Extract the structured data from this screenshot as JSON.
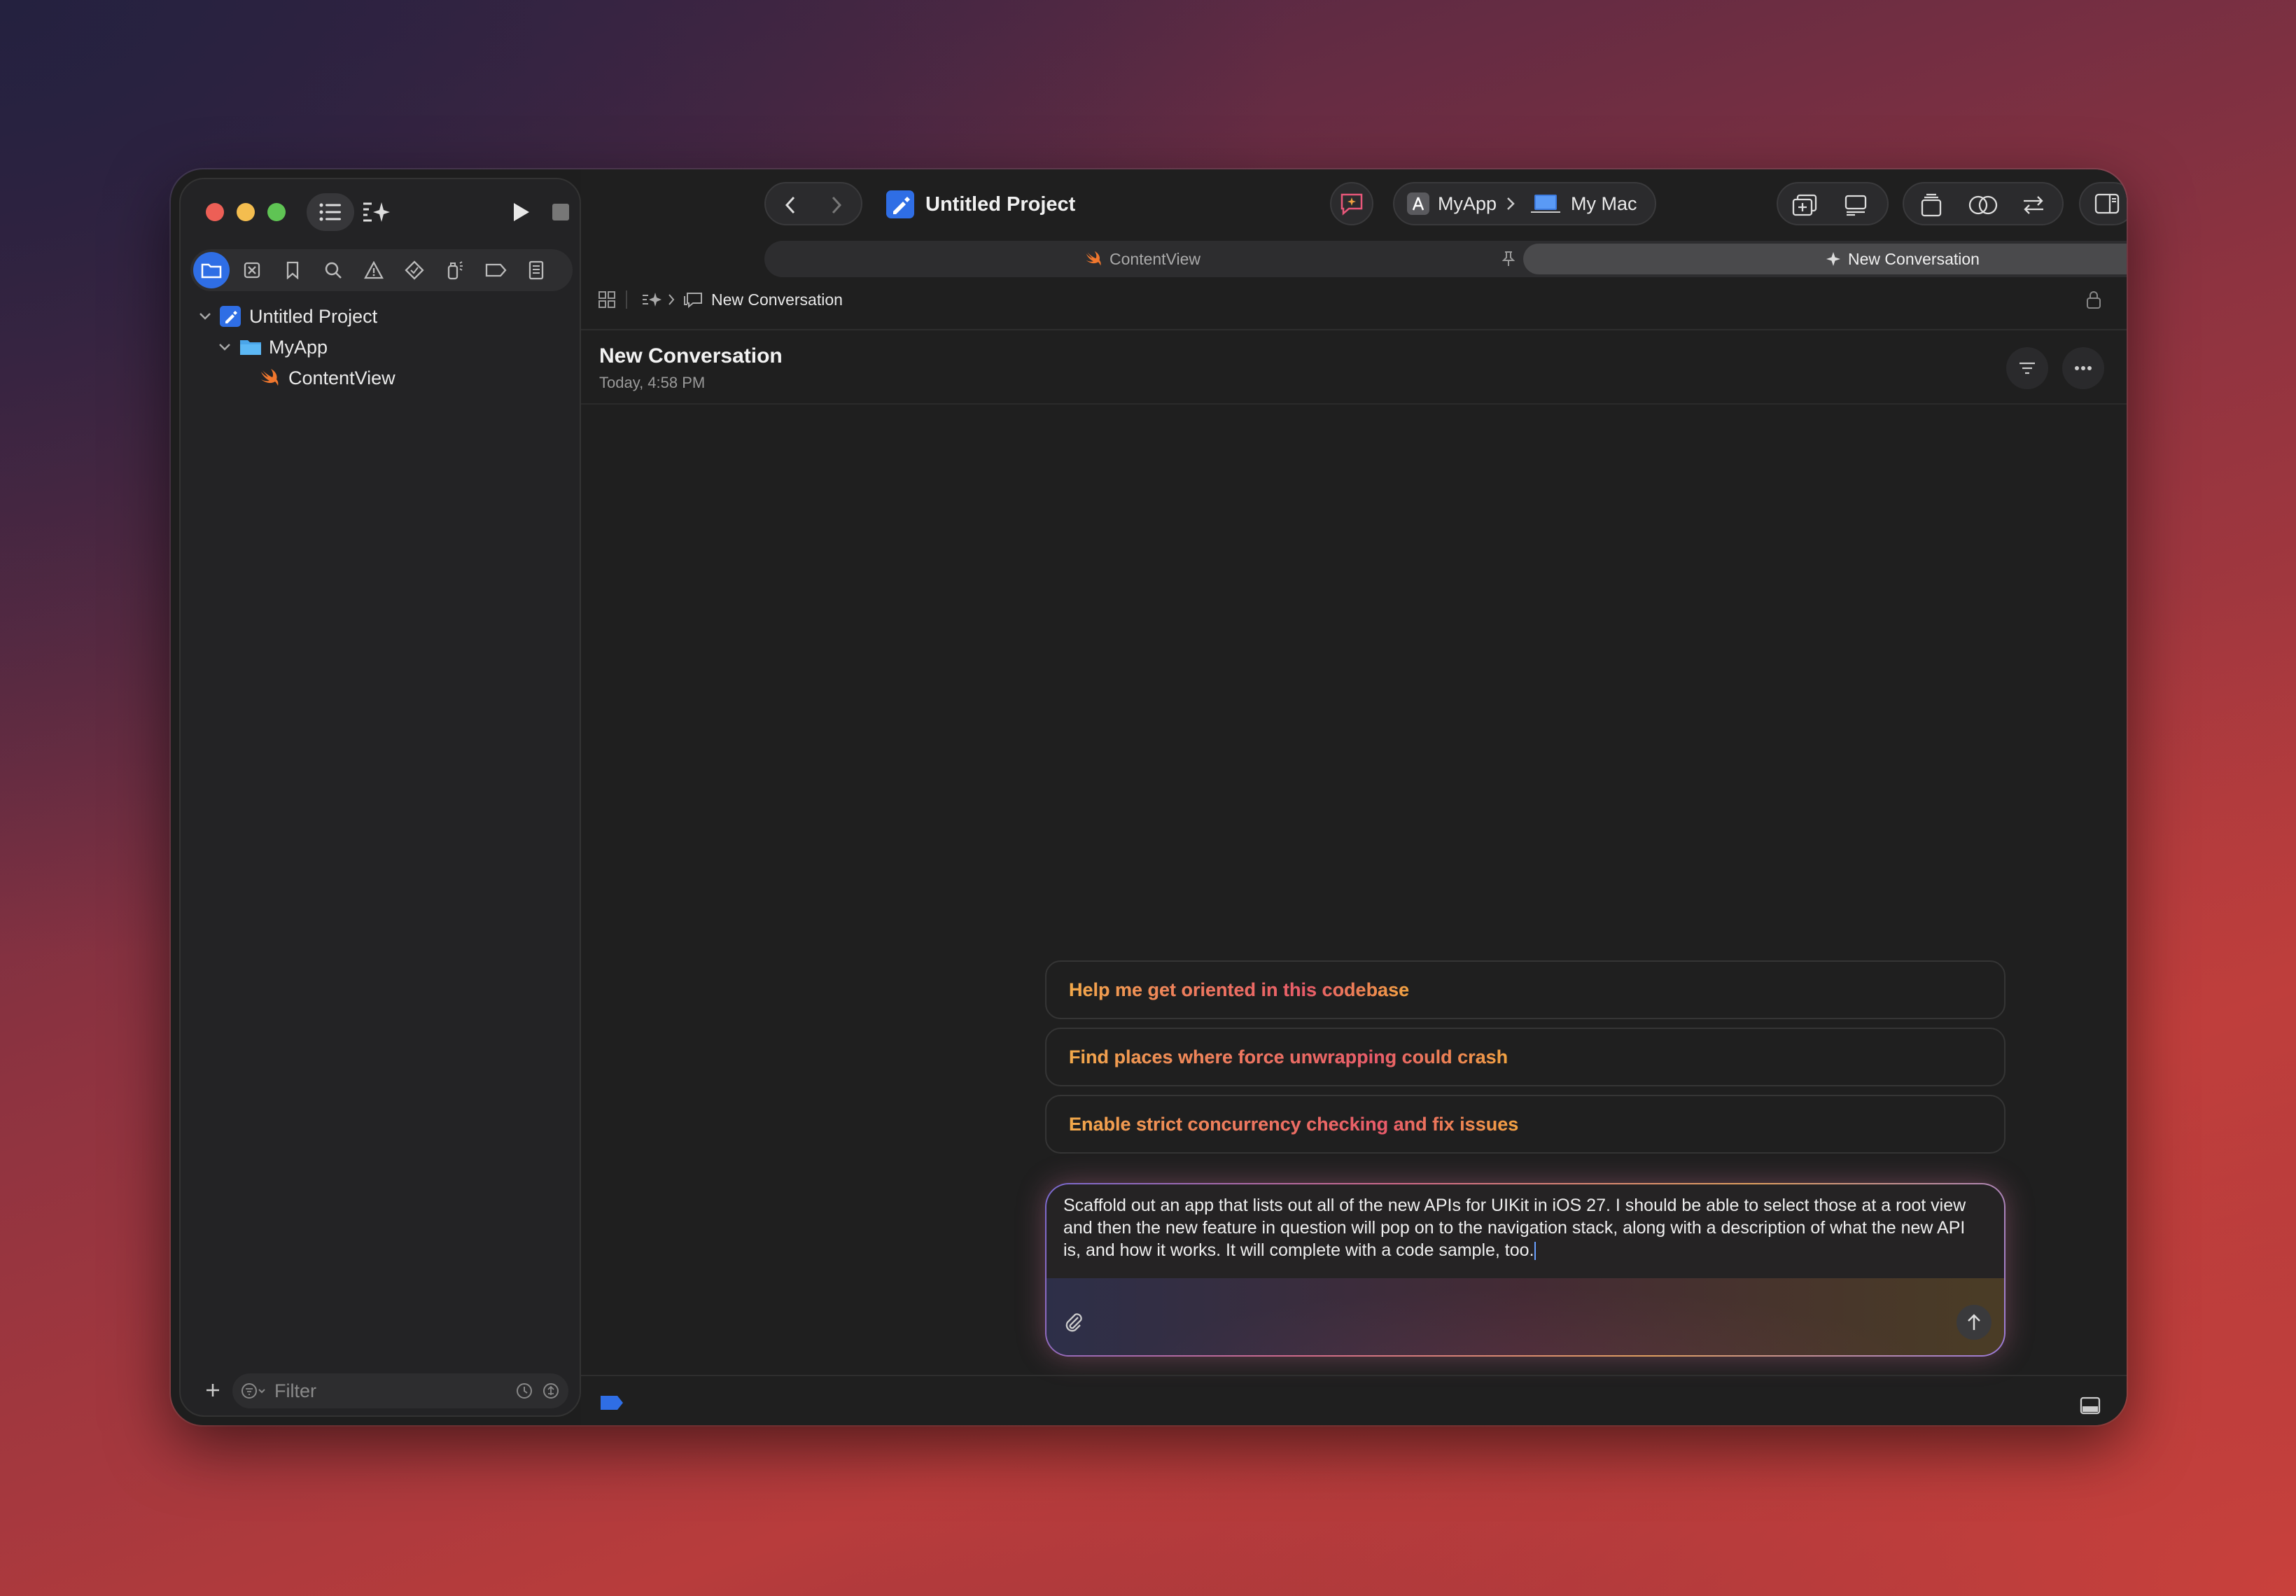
{
  "toolbar": {
    "project_title": "Untitled Project",
    "scheme": "MyApp",
    "destination": "My Mac"
  },
  "tabs": [
    {
      "label": "ContentView",
      "active": false
    },
    {
      "label": "New Conversation",
      "active": true
    }
  ],
  "breadcrumb": {
    "current": "New Conversation"
  },
  "navigator": {
    "tree": [
      {
        "label": "Untitled Project",
        "level": 0,
        "icon": "project-icon"
      },
      {
        "label": "MyApp",
        "level": 1,
        "icon": "folder-icon"
      },
      {
        "label": "ContentView",
        "level": 2,
        "icon": "swift-file-icon"
      }
    ],
    "filter_placeholder": "Filter"
  },
  "conversation": {
    "title": "New Conversation",
    "timestamp": "Today, 4:58 PM",
    "suggestions": [
      "Help me get oriented in this codebase",
      "Find places where force unwrapping could crash",
      "Enable strict concurrency checking and fix issues"
    ],
    "prompt_text": "Scaffold out an app that lists out all of the new APIs for UIKit in iOS 27. I should be able to select those at a root view and then the new feature in question will pop on to the navigation stack, along with a description of what the new API is, and how it works. It will complete with a code sample, too."
  },
  "colors": {
    "accent": "#2f6ee5",
    "close": "#ed5f56",
    "minimize": "#f4bd4f",
    "zoom": "#5fc454"
  }
}
